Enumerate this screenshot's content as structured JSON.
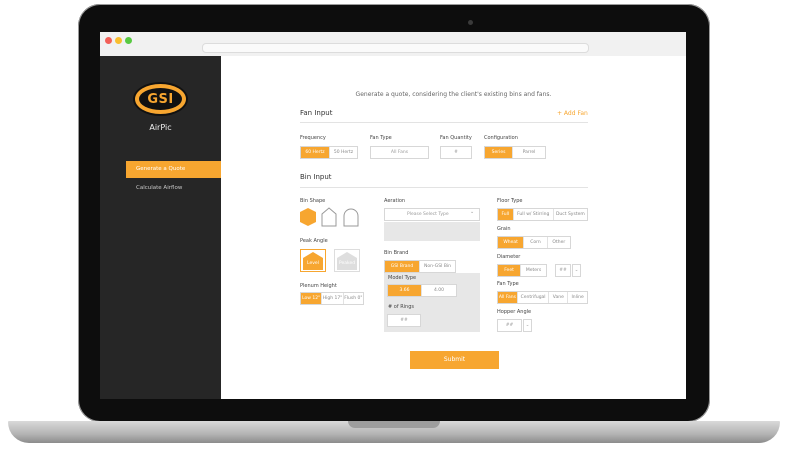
{
  "sidebar": {
    "logo_text": "GSI",
    "app_name": "AirPic",
    "nav": [
      {
        "label": "Generate a Quote",
        "active": true
      },
      {
        "label": "Calculate Airflow",
        "active": false
      }
    ]
  },
  "intro": "Generate a quote, considering the client's existing bins and fans.",
  "fan_input": {
    "title": "Fan Input",
    "add_fan": "+ Add Fan",
    "frequency": {
      "label": "Frequency",
      "options": [
        "60 Hertz",
        "50 Hertz"
      ],
      "selected": "60 Hertz"
    },
    "fan_type": {
      "label": "Fan Type",
      "placeholder": "All Fans"
    },
    "fan_quantity": {
      "label": "Fan Quantity",
      "placeholder": "#"
    },
    "configuration": {
      "label": "Configuration",
      "options": [
        "Series",
        "Parrel"
      ],
      "selected": "Series"
    }
  },
  "bin_input": {
    "title": "Bin Input",
    "bin_shape": {
      "label": "Bin Shape"
    },
    "peak_angle": {
      "label": "Peak Angle",
      "options": [
        "Level",
        "Peaked"
      ],
      "selected": "Level"
    },
    "plenum_height": {
      "label": "Plenum Height",
      "options": [
        "Low 12\"",
        "High 17\"",
        "Flush 0\""
      ],
      "selected": "Low 12\""
    },
    "aeration": {
      "label": "Aeration",
      "placeholder": "Please Select Type"
    },
    "bin_brand": {
      "label": "Bin Brand",
      "options": [
        "GSI Brand",
        "Non-GSI Bin"
      ],
      "selected": "GSI Brand"
    },
    "model_type": {
      "label": "Model Type",
      "options": [
        "3.66",
        "4.00"
      ],
      "selected": "3.66"
    },
    "rings": {
      "label": "# of Rings",
      "placeholder": "##"
    },
    "floor_type": {
      "label": "Floor Type",
      "options": [
        "Full",
        "Full w/ Stirring",
        "Duct System"
      ],
      "selected": "Full"
    },
    "grain": {
      "label": "Grain",
      "options": [
        "Wheat",
        "Corn",
        "Other"
      ],
      "selected": "Wheat"
    },
    "diameter": {
      "label": "Diameter",
      "options": [
        "Feet",
        "Meters"
      ],
      "selected": "Feet",
      "placeholder": "##"
    },
    "fan_type": {
      "label": "Fan Type",
      "options": [
        "All Fans",
        "Centrifugal",
        "Vane",
        "Inline"
      ],
      "selected": "All Fans"
    },
    "hopper_angle": {
      "label": "Hopper Angle",
      "placeholder": "##"
    }
  },
  "submit_label": "Submit",
  "colors": {
    "accent": "#f7a630",
    "sidebar": "#262626"
  }
}
